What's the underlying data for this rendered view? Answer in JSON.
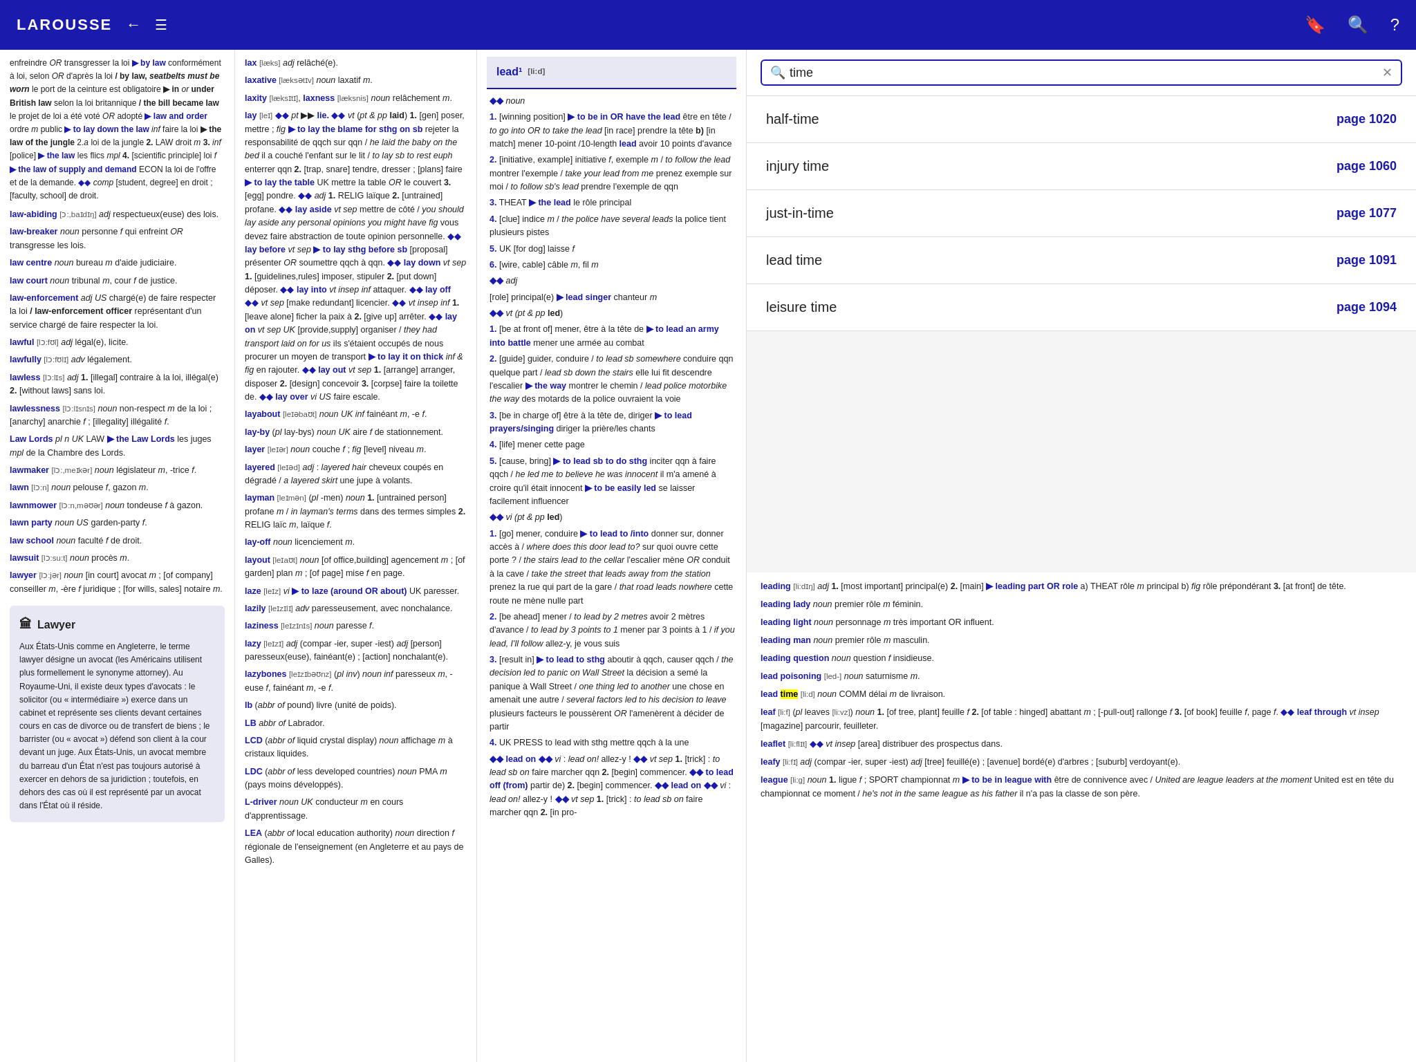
{
  "header": {
    "logo": "LAROUSSE",
    "back_icon": "←",
    "menu_icon": "☰",
    "bookmark_icon": "🔖",
    "search_icon": "🔍",
    "help_icon": "?"
  },
  "search": {
    "placeholder": "time",
    "value": "time",
    "clear_icon": "✕"
  },
  "index_items": [
    {
      "term": "half-time",
      "page": "page 1020"
    },
    {
      "term": "injury time",
      "page": "page 1060"
    },
    {
      "term": "just-in-time",
      "page": "page 1077"
    },
    {
      "term": "lead time",
      "page": "page 1091"
    },
    {
      "term": "leisure time",
      "page": "page 1094"
    }
  ],
  "left_col": {
    "top_text": "enfreindre OR transgresser la loi ▶ by law conformément à loi, selon OR d'après la loi ▶ by law, seatbelts must be worn le port de la ceinture est obligatoire ▶ in or under British law selon la loi britannique ▶ the bill became law le projet de loi a été voté OR adopté ▶ law and order ordre m public ▶ to lay down the law inf faire la loi ▶ the law of the jungle 2.a loi de la jungle 2. LAW droit m 3. inf [police] ▶ the law les flics mpl 4. [scientific principle] loi f ▶ the law of supply and demand ECON la loi de l'offre et de la demande. ◆◆ comp [student, degree] en droit ; [faculty, school] de droit.",
    "entries": [
      {
        "headword": "law-abiding",
        "pron": "[ɔ:,baɪdɪŋ]",
        "pos": "adj",
        "def": "respectueux(euse) des lois."
      },
      {
        "headword": "law-breaker",
        "pos": "noun",
        "def": "personne f qui enfreint OR transgresse les lois."
      },
      {
        "headword": "law centre",
        "pos": "noun",
        "def": "bureau m d'aide judiciaire."
      },
      {
        "headword": "law court",
        "pos": "noun",
        "def": "tribunal m, cour f de justice."
      },
      {
        "headword": "law-enforcement",
        "pos": "adj US",
        "def": "chargé(e) de faire respecter la loi ▶ law-enforcement officer représentant d'un service chargé de faire respecter la loi."
      },
      {
        "headword": "lawful",
        "pron": "[lɔ:fʊl]",
        "pos": "adj",
        "def": "légal(e), licite."
      },
      {
        "headword": "lawfully",
        "pron": "[lɔ:fʊlɪ]",
        "pos": "adv",
        "def": "légalement."
      },
      {
        "headword": "lawless",
        "pron": "[lɔ:lɪs]",
        "pos": "adj",
        "def": "1. [illegal] contraire à la loi, illégal(e) 2. [without laws] sans loi."
      },
      {
        "headword": "lawlessness",
        "pron": "[lɔ:lɪsnɪs]",
        "pos": "noun",
        "def": "non-respect m de la loi ; [anarchy] anarchie f ; [illegality] illégalité f."
      },
      {
        "headword": "Law Lords",
        "pos": "pl n UK LAW",
        "def": "▶ the Law Lords les juges mpl de la Chambre des Lords."
      },
      {
        "headword": "lawmaker",
        "pron": "[lɔ:,meɪkər]",
        "pos": "noun",
        "def": "législateur m, -trice f."
      },
      {
        "headword": "lawn",
        "pron": "[lɔ:n]",
        "pos": "noun",
        "def": "pelouse f, gazon m."
      },
      {
        "headword": "lawnmower",
        "pron": "[lɔ:n,məʊər]",
        "pos": "noun",
        "def": "tondeuse f à gazon."
      },
      {
        "headword": "lawn party",
        "pos": "noun US",
        "def": "garden-party f."
      },
      {
        "headword": "law school",
        "pos": "noun",
        "def": "faculté f de droit."
      },
      {
        "headword": "lawsuit",
        "pron": "[lɔ:su:t]",
        "pos": "noun",
        "def": "procès m."
      },
      {
        "headword": "lawyer",
        "pron": "[lɔ:jər]",
        "pos": "noun",
        "def": "[in court] avocat m ; [of company] conseiller m, -ère f juridique ; [for wills, sales] notaire m."
      }
    ],
    "lawyer_box": {
      "title": "Lawyer",
      "text": "Aux États-Unis comme en Angleterre, le terme lawyer désigne un avocat (les Américains utilisent plus formellement le synonyme attorney). Au Royaume-Uni, il existe deux types d'avocats : le solicitor (ou « intermédiaire ») exerce dans un cabinet et représente ses clients devant certaines cours en cas de divorce ou de transfert de biens ; le barrister (ou « avocat ») défend son client à la cour devant un juge. Aux États-Unis, un avocat membre du barreau d'un État n'est pas toujours autorisé à exercer en dehors de sa juridiction ; toutefois, en dehors des cas où il est représenté par un avocat dans l'État où il réside."
    }
  },
  "middle_col": {
    "entries": [
      {
        "headword": "lax",
        "pron": "[læks]",
        "pos": "adj",
        "def": "relâché(e)."
      },
      {
        "headword": "laxative",
        "pron": "[læksətɪv]",
        "pos": "noun",
        "def": "laxatif m."
      },
      {
        "headword": "laxity",
        "pron": "[læksɪtɪ]",
        "headword2": "laxness",
        "pron2": "[læksnis]",
        "pos": "noun",
        "def": "relâchement m."
      },
      {
        "headword": "lay",
        "pron": "[leɪ]",
        "senses": [
          "pt ▶▶ lie. ◆◆ vt (pt & pp laid) 1. [gen] poser, mettre ; fig ▶ to lay the blame for sthg on sb rejeter la responsabilité de qqch sur qqn / he laid the baby on the bed il a couché l'enfant sur le lit / to lay sb to rest euph enterrer qqn 2. [trap, snare] tendre, dresser ; [plans] faire ▶ to lay the table UK mettre la table OR le couvert 3. [egg] pondre. ◆◆ adj 1. RELIG laïque 2. [untrained] profane. ◆◆ lay aside vt sep mettre de côté / you should lay aside any personal opinions you might have fig vous devez faire abstraction de toute opinion personnelle. ◆◆ lay before vt sep ▶ to lay sthg before sb [proposal] présenter OR soumettre qqch à qqn. ◆◆ lay down vt sep 1. [guidelines,rules] imposer, stipuler 2. [put down] déposer. ◆◆ lay into vt insep inf attaquer. ◆◆ lay off ◆◆ vt sep [make redundant] licencier. ◆◆ vt insep inf 1. [leave alone] ficher la paix à 2. [give up] arrêter. ◆◆ lay on vt sep UK [provide,supply] organiser / they had transport laid on for us ils s'étaient occupés de nous procurer un moyen de transport ▶ to lay it on thick inf & fig en rajouter. ◆◆ lay out vt sep 1. [arrange] arranger, disposer 2. [design] concevoir 3. [corpse] faire la toilette de. ◆◆ lay over vi US faire escale."
        ]
      },
      {
        "headword": "layabout",
        "pron": "[leɪəbaʊt]",
        "pos": "noun UK inf",
        "def": "fainéant m, -e f."
      },
      {
        "headword": "lay-by",
        "pron": "(pl lay-bys)",
        "pos": "noun UK",
        "def": "aire f de stationnement."
      },
      {
        "headword": "layer",
        "pron": "[leɪər]",
        "pos": "noun",
        "def": "couche f ; fig [level] niveau m."
      },
      {
        "headword": "layered",
        "pron": "[leɪəd]",
        "pos": "adj",
        "def": "layered hair cheveux coupés en dégradé / a layered skirt une jupe à volants."
      },
      {
        "headword": "layman",
        "pron": "[leɪmən]",
        "pos": "(pl -men) noun",
        "def": "1. [untrained person] profane m / in layman's terms dans des termes simples 2. RELIG laïc m, laïque f."
      },
      {
        "headword": "lay-off",
        "pos": "noun",
        "def": "licenciement m."
      },
      {
        "headword": "layout",
        "pron": "[leɪaʊt]",
        "pos": "noun",
        "def": "[of office,building] agencement m ; [of garden] plan m ; [of page] mise f en page."
      },
      {
        "headword": "laze",
        "pron": "[leɪz]",
        "pos": "vi",
        "def": "▶ to laze (around OR about) UK paresser."
      },
      {
        "headword": "lazily",
        "pron": "[leɪzɪlɪ]",
        "pos": "adv",
        "def": "paresseusement, avec nonchalance."
      },
      {
        "headword": "laziness",
        "pron": "[leɪzɪnɪs]",
        "pos": "noun",
        "def": "paresse f."
      },
      {
        "headword": "lazy",
        "pron": "[leɪzɪ]",
        "pos": "adj",
        "def": "(compar -ier, super -iest) adj [person] paresseux(euse), fainéant(e) ; [action] nonchalant(e)."
      },
      {
        "headword": "lazybones",
        "pron": "[leɪzɪbəʊnz]",
        "pos": "(pl inv) noun inf",
        "def": "paresseux m, -euse f, fainéant m, -e f."
      },
      {
        "headword": "lb",
        "pos": "(abbr of pound)",
        "def": "livre (unité de poids)."
      },
      {
        "headword": "LB",
        "pos": "abbr of Labrador."
      },
      {
        "headword": "LCD",
        "pos": "(abbr of liquid crystal display)",
        "def": "noun affichage m à cristaux liquides."
      },
      {
        "headword": "LDC",
        "pos": "(abbr of less developed countries)",
        "def": "noun PMA m (pays moins développés)."
      },
      {
        "headword": "L-driver",
        "pos": "noun UK",
        "def": "conducteur m en cours d'apprentissage."
      },
      {
        "headword": "LEA",
        "pos": "(abbr of local education authority)",
        "def": "noun direction f régionale de l'enseignement (en Angleterre et au pays de Galles)."
      }
    ]
  },
  "lead_col": {
    "header": "lead¹ [li:d]",
    "senses": [
      {
        "num": "●",
        "pos": "noun",
        "content": ""
      },
      {
        "num": "1.",
        "label": "[winning position]",
        "content": "▶ to be in OR have the lead être en tête / to go into OR to take the lead [in race] prendre la tête b) [in match] mener 10-point /10-length lead avoir 10 points d'avance"
      },
      {
        "num": "2.",
        "label": "[initiative, example]",
        "content": "initiative f, exemple m / to follow the lead montrer l'exemple / take your lead from me prenez exemple sur moi / to follow sb's lead prendre l'exemple de qqn"
      },
      {
        "num": "3.",
        "label": "THEAT",
        "content": "▶ the lead le rôle principal"
      },
      {
        "num": "4.",
        "label": "[clue]",
        "content": "indice m / the police have several leads la police tient plusieurs pistes"
      },
      {
        "num": "5.",
        "label": "UK [for dog]",
        "content": "laisse f"
      },
      {
        "num": "6.",
        "label": "[wire, cable]",
        "content": "câble m, fil m"
      },
      {
        "num": "●",
        "pos": "adj",
        "content": ""
      },
      {
        "content": "[role] principal(e) ▶ lead singer chanteur m"
      },
      {
        "num": "●",
        "pos": "vt (pt & pp led)",
        "content": ""
      },
      {
        "num": "1.",
        "label": "[be at front of]",
        "content": "mener, être à la tête de ▶ to lead an army into battle mener une armée au combat"
      },
      {
        "num": "2.",
        "label": "[guide]",
        "content": "guider, conduire / to lead sb somewhere conduire qqn quelque part / lead sb down the stairs elle lui fit descendre l'escalier ▶ the way montrer le chemin / lead police motorbike the way des motards de la police ouvraient la voie"
      },
      {
        "num": "3.",
        "label": "[be in charge of]",
        "content": "être à la tête de, diriger ▶ to lead prayers/singing diriger la prière/les chants"
      },
      {
        "num": "4.",
        "label": "[life]",
        "content": "mener cette page"
      },
      {
        "num": "5.",
        "label": "[cause, bring]",
        "content": "▶ to lead sb to do sthg inciter qqn à faire qqch / he led me to believe he was innocent il m'a amené à croire qu'il était innocent ▶ to be easily led se laisser facilement influencer"
      },
      {
        "num": "●",
        "pos": "vi (pt & pp led)",
        "content": ""
      },
      {
        "num": "1.",
        "label": "[go]",
        "content": "mener, conduire ▶ to lead to /into donner sur, donner accès à / where does this door lead to? sur quoi ouvre cette porte ? / the stairs lead to the cellar l'escalier mène OR conduit à la cave / take the street that leads away from the station prenez la rue qui part de la gare / that road leads nowhere cette route ne mène nulle part"
      },
      {
        "num": "2.",
        "label": "[be ahead]",
        "content": "mener / to lead by 2 metres avoir 2 mètres d'avance / to lead by 3 points to 1 mener par 3 points à 1 / if you lead, I'll follow allez-y, je vous suis"
      },
      {
        "num": "3.",
        "label": "[result in]",
        "content": "▶ to lead to sthg aboutir à qqch, causer qqch / the decision led to panic on Wall Street la décision a semé la panique à Wall Street / one thing led to another une chose en amenait une autre / several factors led to his decision to leave plusieurs facteurs le poussèrent OR l'amenèrent à décider de partir"
      },
      {
        "num": "4.",
        "label": "UK PRESS",
        "content": "to lead with sthg mettre qqch à la une"
      },
      {
        "content": "◆◆ lead on ◆◆ vi : lead on! allez-y ! ◆◆ vt sep 1. [trick] : to lead sb on faire marcher qqn 2. [begin] commencer. ◆◆ to lead off (from) partir de) 2. [begin] commencer. ◆◆ lead on ◆◆ vi : lead on! allez-y ! ◆◆ vt sep 1. [trick] : to lead sb on faire marcher qqn 2. [in pro-"
      }
    ]
  },
  "right_entries": {
    "entries": [
      {
        "headword": "leading",
        "pron": "[li:dɪŋ]",
        "pos": "adj",
        "def": "1. [most important] principal(e) 2. [main] ▶ leading part OR role a) THEAT rôle m principal b) fig rôle prépondérant 3. [at front] de tête."
      },
      {
        "headword": "leading lady",
        "pos": "noun",
        "def": "premier rôle m féminin."
      },
      {
        "headword": "leading light",
        "pos": "noun",
        "def": "personnage m très important OR influent."
      },
      {
        "headword": "leading man",
        "pos": "noun",
        "def": "premier rôle m masculin."
      },
      {
        "headword": "leading question",
        "pos": "noun",
        "def": "question f insidieuse."
      },
      {
        "headword": "lead poisoning",
        "pron": "[led-]",
        "pos": "noun",
        "def": "saturnisme m."
      },
      {
        "headword": "lead time",
        "pron": "[li:d]",
        "pos": "noun COMM",
        "def": "délai m de livraison.",
        "highlighted": "time"
      },
      {
        "headword": "leaf",
        "pron": "[li:f]",
        "pos": "(pl leaves [li:vz]) noun",
        "def": "1. [of tree, plant] feuille f 2. [of table : hinged] abattant m ; [-pull-out] rallonge f 3. [of book] feuille f, page f. ◆◆ leaf through vt insep [magazine] parcourir, feuilleter."
      },
      {
        "headword": "leaflet",
        "pron": "[li:flɪt]",
        "pos": "◆◆",
        "def": "vt insep [area] distribuer des prospectus dans."
      },
      {
        "headword": "leafy",
        "pron": "[li:fɪ]",
        "pos": "adj",
        "def": "(compar -ier, super -iest) adj [tree] feuillé(e) ; [avenue] bordé(e) d'arbres ; [suburb] verdoyant(e)."
      },
      {
        "headword": "league",
        "pron": "[li:g]",
        "pos": "noun",
        "def": "1. ligue f ; SPORT championnat m ▶ to be in league with être de connivence avec / United are league leaders at the moment United est en tête du championnat ce moment / he's not in the same league as his father il n'a pas la classe de son père."
      }
    ]
  }
}
